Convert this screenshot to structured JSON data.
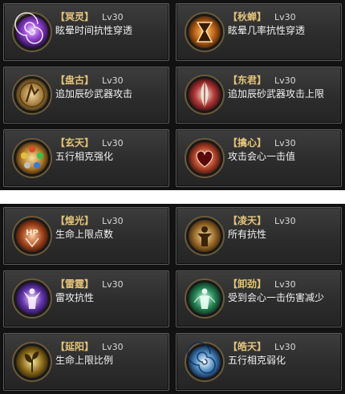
{
  "panels": [
    {
      "cards": [
        {
          "name": "【冥灵】",
          "level": "Lv30",
          "desc": "眩晕时间抗性穿透",
          "icon": "swirl-icon",
          "color": "#8a3fd0"
        },
        {
          "name": "【秋蝉】",
          "level": "Lv30",
          "desc": "眩晕几率抗性穿透",
          "icon": "hourglass-icon",
          "color": "#c0661c"
        },
        {
          "name": "【盘古】",
          "level": "Lv30",
          "desc": "追加辰砂武器攻击",
          "icon": "rune-circle-icon",
          "color": "#a07a3a"
        },
        {
          "name": "【东君】",
          "level": "Lv30",
          "desc": "追加辰砂武器攻击上限",
          "icon": "feather-icon",
          "color": "#b23a3a"
        },
        {
          "name": "【玄天】",
          "level": "Lv30",
          "desc": "五行相克强化",
          "icon": "five-elements-icon",
          "color": "#b07a2a"
        },
        {
          "name": "【擒心】",
          "level": "Lv30",
          "desc": "攻击会心一击值",
          "icon": "heart-icon",
          "color": "#b0442a"
        }
      ]
    },
    {
      "cards": [
        {
          "name": "【煌光】",
          "level": "Lv30",
          "desc": "生命上限点数",
          "icon": "hp-icon",
          "color": "#a0461e"
        },
        {
          "name": "【凌天】",
          "level": "Lv30",
          "desc": "所有抗性",
          "icon": "shield-figure-icon",
          "color": "#9a6a2a"
        },
        {
          "name": "【雷霆】",
          "level": "Lv30",
          "desc": "雷攻抗性",
          "icon": "lightning-figure-icon",
          "color": "#6a3ab0"
        },
        {
          "name": "【卸劲】",
          "level": "Lv30",
          "desc": "受到会心一击伤害减少",
          "icon": "green-figure-icon",
          "color": "#2a8a5a"
        },
        {
          "name": "【延阳】",
          "level": "Lv30",
          "desc": "生命上限比例",
          "icon": "plant-icon",
          "color": "#8a6a1a"
        },
        {
          "name": "【皓天】",
          "level": "Lv30",
          "desc": "五行相克弱化",
          "icon": "spiral-icon",
          "color": "#4a8ac0"
        }
      ]
    }
  ]
}
